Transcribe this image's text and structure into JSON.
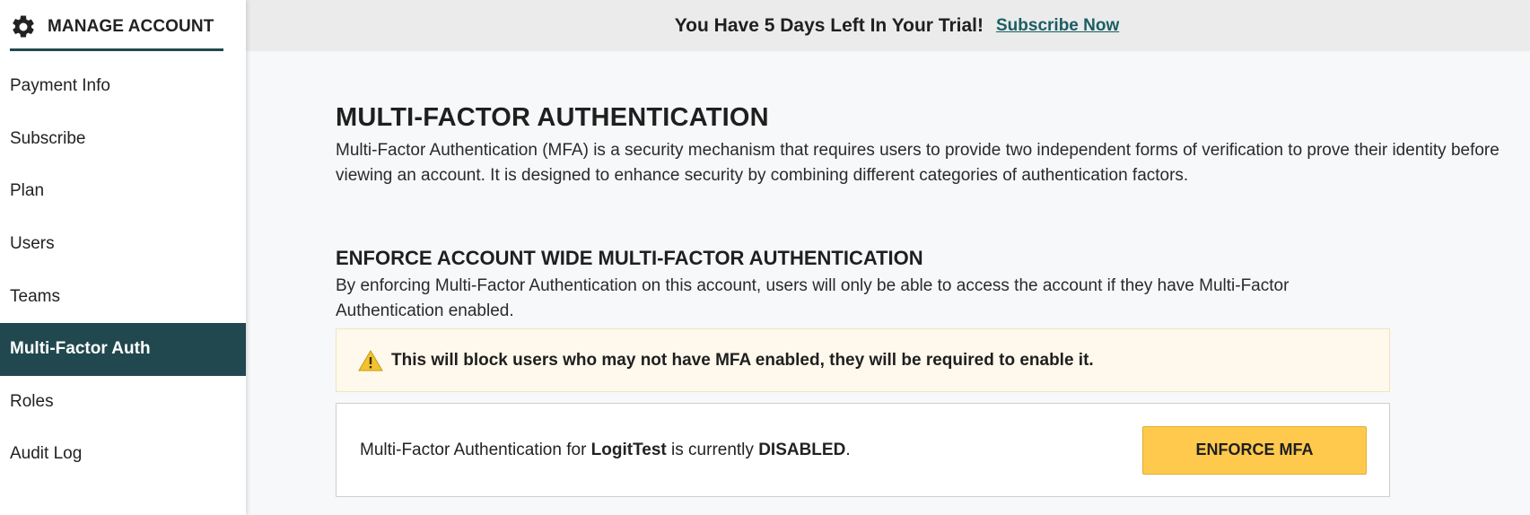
{
  "sidebar": {
    "header_title": "MANAGE ACCOUNT",
    "header_icon": "gear-icon",
    "items": [
      {
        "label": "Payment Info",
        "active": false
      },
      {
        "label": "Subscribe",
        "active": false
      },
      {
        "label": "Plan",
        "active": false
      },
      {
        "label": "Users",
        "active": false
      },
      {
        "label": "Teams",
        "active": false
      },
      {
        "label": "Multi-Factor Auth",
        "active": true
      },
      {
        "label": "Roles",
        "active": false
      },
      {
        "label": "Audit Log",
        "active": false
      }
    ]
  },
  "trial_banner": {
    "text": "You Have 5 Days Left In Your Trial!",
    "link": "Subscribe Now"
  },
  "main": {
    "title": "MULTI-FACTOR AUTHENTICATION",
    "intro": "Multi-Factor Authentication (MFA) is a security mechanism that requires users to provide two independent forms of verification to prove their identity before viewing an account. It is designed to enhance security by combining different categories of authentication factors.",
    "enforce_title": "ENFORCE ACCOUNT WIDE MULTI-FACTOR AUTHENTICATION",
    "enforce_desc": "By enforcing Multi-Factor Authentication on this account, users will only be able to access the account if they have Multi-Factor Authentication enabled.",
    "warning": {
      "icon": "warning-icon",
      "text": "This will block users who may not have MFA enabled, they will be required to enable it."
    },
    "status": {
      "prefix": "Multi-Factor Authentication for ",
      "account_name": "LogitTest",
      "middle": " is currently ",
      "state": "DISABLED",
      "suffix": "."
    },
    "enforce_button": "ENFORCE MFA"
  },
  "colors": {
    "accent": "#21484e",
    "link": "#1b5e63",
    "button": "#ffc94d",
    "warning_bg": "#fff8ec",
    "warning_icon": "#f2c230"
  }
}
